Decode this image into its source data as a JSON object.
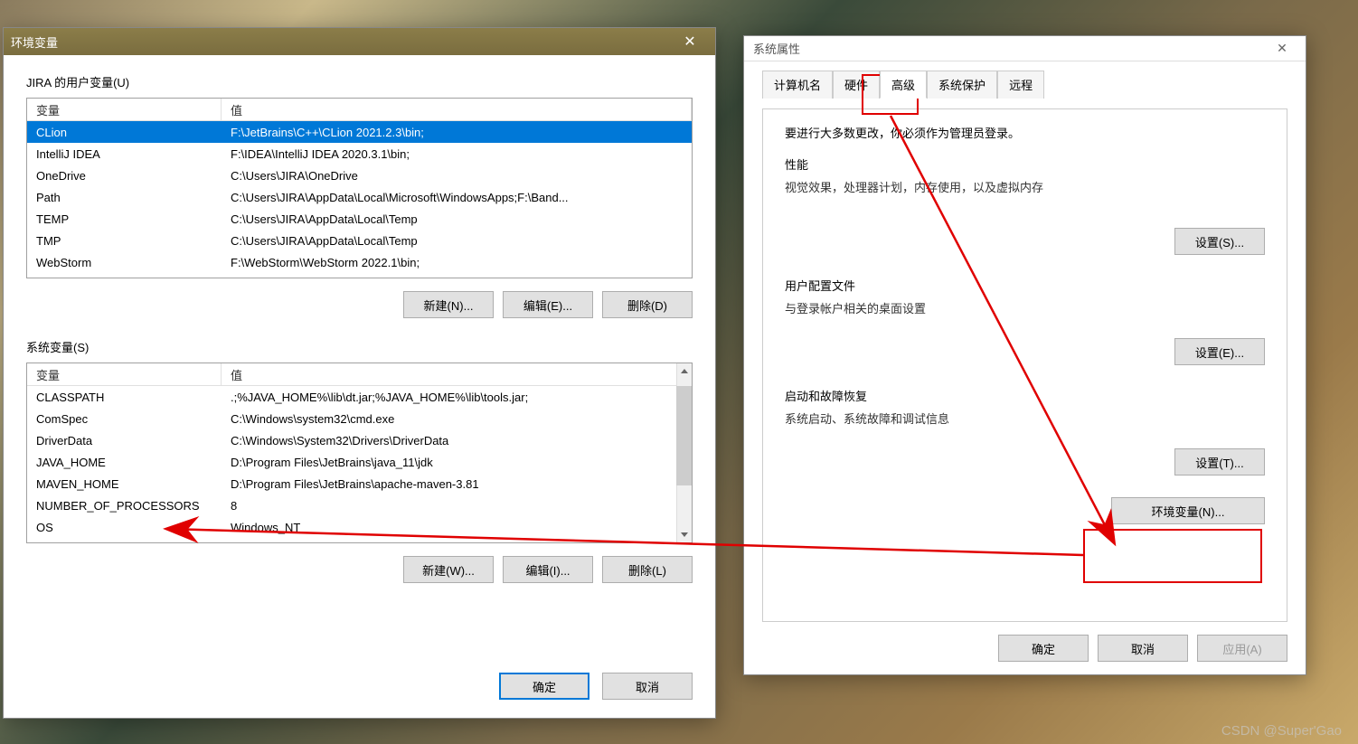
{
  "watermark": "CSDN @Super'Gao",
  "envDialog": {
    "title": "环境变量",
    "userLabel": "JIRA 的用户变量(U)",
    "sysLabel": "系统变量(S)",
    "colVar": "变量",
    "colVal": "值",
    "userVars": [
      {
        "name": "CLion",
        "value": "F:\\JetBrains\\C++\\CLion 2021.2.3\\bin;",
        "sel": true
      },
      {
        "name": "IntelliJ IDEA",
        "value": "F:\\IDEA\\IntelliJ IDEA 2020.3.1\\bin;"
      },
      {
        "name": "OneDrive",
        "value": "C:\\Users\\JIRA\\OneDrive"
      },
      {
        "name": "Path",
        "value": "C:\\Users\\JIRA\\AppData\\Local\\Microsoft\\WindowsApps;F:\\Band..."
      },
      {
        "name": "TEMP",
        "value": "C:\\Users\\JIRA\\AppData\\Local\\Temp"
      },
      {
        "name": "TMP",
        "value": "C:\\Users\\JIRA\\AppData\\Local\\Temp"
      },
      {
        "name": "WebStorm",
        "value": "F:\\WebStorm\\WebStorm 2022.1\\bin;"
      }
    ],
    "sysVars": [
      {
        "name": "CLASSPATH",
        "value": ".;%JAVA_HOME%\\lib\\dt.jar;%JAVA_HOME%\\lib\\tools.jar;"
      },
      {
        "name": "ComSpec",
        "value": "C:\\Windows\\system32\\cmd.exe"
      },
      {
        "name": "DriverData",
        "value": "C:\\Windows\\System32\\Drivers\\DriverData"
      },
      {
        "name": "JAVA_HOME",
        "value": "D:\\Program Files\\JetBrains\\java_11\\jdk"
      },
      {
        "name": "MAVEN_HOME",
        "value": "D:\\Program Files\\JetBrains\\apache-maven-3.81"
      },
      {
        "name": "NUMBER_OF_PROCESSORS",
        "value": "8"
      },
      {
        "name": "OS",
        "value": "Windows_NT"
      }
    ],
    "btnNew": "新建(N)...",
    "btnEdit": "编辑(E)...",
    "btnDel": "删除(D)",
    "btnNewW": "新建(W)...",
    "btnEditI": "编辑(I)...",
    "btnDelL": "删除(L)",
    "btnOk": "确定",
    "btnCancel": "取消"
  },
  "sysDialog": {
    "title": "系统属性",
    "tabs": [
      "计算机名",
      "硬件",
      "高级",
      "系统保护",
      "远程"
    ],
    "activeTab": 2,
    "desc": "要进行大多数更改，你必须作为管理员登录。",
    "perf": {
      "title": "性能",
      "sub": "视觉效果，处理器计划，内存使用，以及虚拟内存",
      "btn": "设置(S)..."
    },
    "profile": {
      "title": "用户配置文件",
      "sub": "与登录帐户相关的桌面设置",
      "btn": "设置(E)..."
    },
    "startup": {
      "title": "启动和故障恢复",
      "sub": "系统启动、系统故障和调试信息",
      "btn": "设置(T)..."
    },
    "envBtn": "环境变量(N)...",
    "btnOk": "确定",
    "btnCancel": "取消",
    "btnApply": "应用(A)"
  }
}
